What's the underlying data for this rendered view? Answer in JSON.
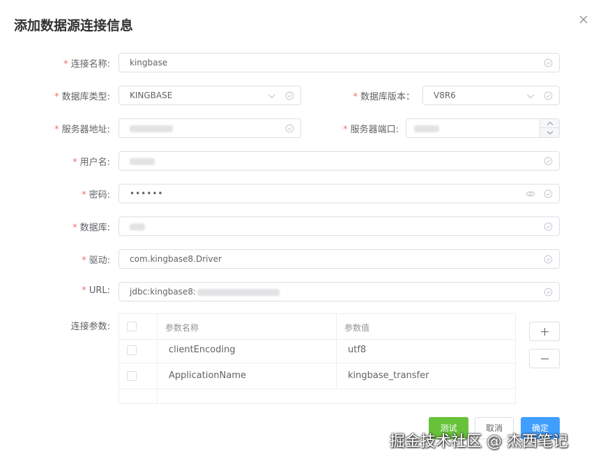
{
  "dialog": {
    "title": "添加数据源连接信息"
  },
  "form": {
    "conn_name": {
      "label": "连接名称:",
      "value": "kingbase",
      "required": true
    },
    "db_type": {
      "label": "数据库类型:",
      "value": "KINGBASE",
      "required": true
    },
    "db_version": {
      "label": "数据库版本：",
      "value": "V8R6",
      "required": true
    },
    "server_addr": {
      "label": "服务器地址:",
      "value": "",
      "required": true
    },
    "server_port": {
      "label": "服务器端口:",
      "value": "",
      "required": true
    },
    "username": {
      "label": "用户名:",
      "value": "",
      "required": true
    },
    "password": {
      "label": "密码:",
      "value": "••••••",
      "required": true
    },
    "database": {
      "label": "数据库:",
      "value": "",
      "required": true
    },
    "driver": {
      "label": "驱动:",
      "value": "com.kingbase8.Driver",
      "required": true
    },
    "url": {
      "label": "URL:",
      "value": "jdbc:kingbase8:",
      "required": true
    },
    "params_label": "连接参数:"
  },
  "params_table": {
    "columns": [
      "参数名称",
      "参数值"
    ],
    "rows": [
      {
        "name": "clientEncoding",
        "value": "utf8"
      },
      {
        "name": "ApplicationName",
        "value": "kingbase_transfer"
      }
    ]
  },
  "buttons": {
    "test": "测试",
    "cancel": "取消",
    "confirm": "确定"
  },
  "watermark": "掘金技术社区 @ 杰西笔记",
  "icons": {
    "close": "close-icon",
    "valid": "check-circle-icon",
    "dropdown": "chevron-down-icon",
    "eye": "eye-icon",
    "plus": "plus-icon",
    "minus": "minus-icon"
  },
  "colors": {
    "required": "#f56c6c",
    "test": "#67c23a",
    "primary": "#409eff",
    "border": "#dcdfe6"
  }
}
